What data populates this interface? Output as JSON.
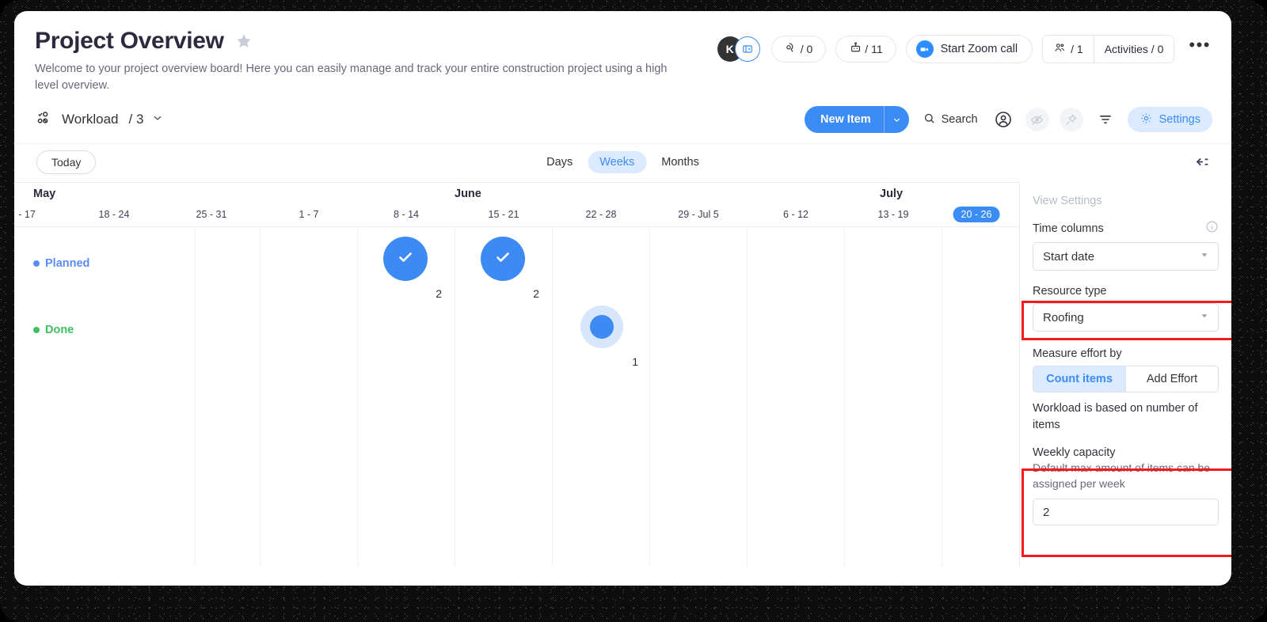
{
  "header": {
    "title": "Project Overview",
    "star_icon": "star-icon",
    "subtitle": "Welcome to your project overview board! Here you can easily manage and track your entire construction project using a high level overview.",
    "avatar_initial": "K",
    "board_icon": "board-view-icon",
    "updates_icon": "updates-icon",
    "updates_count": "/ 0",
    "automations_icon": "automation-robot-icon",
    "automations_count": "/ 11",
    "zoom_label": "Start Zoom call",
    "zoom_icon": "video-camera-icon",
    "invite_icon": "people-icon",
    "invite_count": "/ 1",
    "activities_label": "Activities / 0",
    "more_label": "•••"
  },
  "toolbar": {
    "view_icon": "workload-view-icon",
    "view_label": "Workload",
    "view_count": "/ 3",
    "chevron_icon": "chevron-down-icon",
    "new_item_label": "New Item",
    "new_item_caret": "chevron-down-icon",
    "search_label": "Search",
    "search_icon": "search-icon",
    "person_icon": "person-filter-icon",
    "hide_icon": "eye-slash-icon",
    "pin_icon": "pin-icon",
    "filter_icon": "filter-icon",
    "settings_label": "Settings",
    "settings_icon": "gear-icon"
  },
  "timeline_controls": {
    "today_label": "Today",
    "zoom_tabs": [
      {
        "label": "Days",
        "active": false
      },
      {
        "label": "Weeks",
        "active": true
      },
      {
        "label": "Months",
        "active": false
      }
    ],
    "collapse_icon": "collapse-panel-icon"
  },
  "chart_data": {
    "type": "bar",
    "title": "Workload",
    "xlabel": "",
    "ylabel": "",
    "months": [
      {
        "label": "May",
        "left_pct": 2.3
      },
      {
        "label": "June",
        "left_pct": 44.0
      },
      {
        "label": "July",
        "left_pct": 86.9
      }
    ],
    "categories": [
      "- 17",
      "18 - 24",
      "25 - 31",
      "1 - 7",
      "8 - 14",
      "15 - 21",
      "22 - 28",
      "29 - Jul 5",
      "6 - 12",
      "13 - 19",
      "20 - 26"
    ],
    "current_period": "20 - 26",
    "rows": [
      {
        "name": "Planned",
        "color": "#5a8df7",
        "values": [
          0,
          0,
          0,
          0,
          2,
          2,
          0,
          0,
          0,
          0,
          0
        ],
        "capacity": 2
      },
      {
        "name": "Done",
        "color": "#3fbf63",
        "values": [
          0,
          0,
          0,
          0,
          0,
          0,
          1,
          0,
          0,
          0,
          0
        ],
        "capacity": 2
      }
    ],
    "bubbles": [
      {
        "row": "Planned",
        "period": "8 - 14",
        "value": "2",
        "full": true,
        "check_icon": "check-icon"
      },
      {
        "row": "Planned",
        "period": "15 - 21",
        "value": "2",
        "full": true,
        "check_icon": "check-icon"
      },
      {
        "row": "Done",
        "period": "22 - 28",
        "value": "1",
        "full": false
      }
    ]
  },
  "settings_panel": {
    "title": "View Settings",
    "time_columns_label": "Time columns",
    "info_icon": "info-icon",
    "time_columns_value": "Start date",
    "resource_type_label": "Resource type",
    "resource_type_value": "Roofing",
    "measure_effort_label": "Measure effort by",
    "measure_options": [
      {
        "label": "Count items",
        "active": true
      },
      {
        "label": "Add Effort",
        "active": false
      }
    ],
    "measure_description": "Workload is based on number of items",
    "weekly_capacity_label": "Weekly capacity",
    "weekly_capacity_desc": "Default max amount of items can be assigned per week",
    "weekly_capacity_value": "2",
    "dropdown_icon": "chevron-down-icon"
  },
  "colors": {
    "accent": "#3b8cf5",
    "planned": "#5a8df7",
    "done": "#3fbf63",
    "highlight": "#f41b1b",
    "bubble_fill": "#3d8bf2",
    "bubble_halo": "#d6e7fb"
  }
}
